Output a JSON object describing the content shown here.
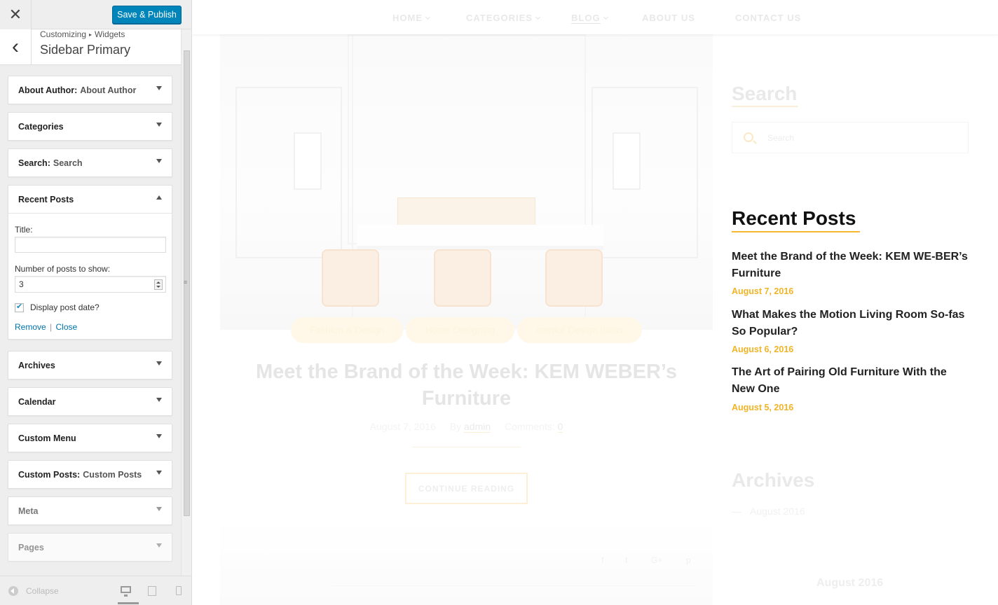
{
  "customizer": {
    "close_glyph": "✕",
    "save_label": "Save & Publish",
    "back_glyph": "‹",
    "breadcrumb_root": "Customizing",
    "breadcrumb_sep": "▸",
    "breadcrumb_section": "Widgets",
    "panel_title": "Sidebar Primary",
    "widgets": [
      {
        "name": "About Author",
        "sub": "About Author",
        "expanded": false
      },
      {
        "name": "Categories",
        "sub": "",
        "expanded": false
      },
      {
        "name": "Search",
        "sub": "Search",
        "expanded": false
      },
      {
        "name": "Recent Posts",
        "sub": "",
        "expanded": true
      },
      {
        "name": "Archives",
        "sub": "",
        "expanded": false
      },
      {
        "name": "Calendar",
        "sub": "",
        "expanded": false
      },
      {
        "name": "Custom Menu",
        "sub": "",
        "expanded": false
      },
      {
        "name": "Custom Posts",
        "sub": "Custom Posts",
        "expanded": false
      },
      {
        "name": "Meta",
        "sub": "",
        "expanded": false
      },
      {
        "name": "Pages",
        "sub": "",
        "expanded": false
      }
    ],
    "recent_posts_form": {
      "title_label": "Title:",
      "title_value": "",
      "number_label": "Number of posts to show:",
      "number_value": "3",
      "display_date_label": "Display post date?",
      "display_date_checked": true,
      "remove_label": "Remove",
      "separator": "|",
      "close_label": "Close"
    },
    "collapse_label": "Collapse",
    "device_icons": [
      "desktop-icon",
      "tablet-icon",
      "mobile-icon"
    ]
  },
  "site": {
    "nav": [
      {
        "label": "HOME",
        "dropdown": true
      },
      {
        "label": "CATEGORIES",
        "dropdown": true
      },
      {
        "label": "BLOG",
        "dropdown": true,
        "active": true
      },
      {
        "label": "ABOUT US",
        "dropdown": false
      },
      {
        "label": "CONTACT US",
        "dropdown": false
      }
    ],
    "post": {
      "categories": [
        "Fashion & Design",
        "Home Designing",
        "Interior Design Ideas"
      ],
      "title": "Meet the Brand of the Week: KEM WEBER’s Furniture",
      "date": "August 7, 2016",
      "by_label": "By",
      "author": "admin",
      "comments_label": "Comments:",
      "comments_count": "0",
      "continue_label": "CONTINUE READING",
      "social_icons": [
        "facebook-icon",
        "twitter-icon",
        "google-plus-icon",
        "pinterest-icon"
      ]
    },
    "sidebar": {
      "search_heading": "Search",
      "search_placeholder": "Search",
      "recent_heading": "Recent Posts",
      "recent_posts": [
        {
          "title": "Meet the Brand of the Week: KEM WE-BER’s Furniture",
          "date": "August 7, 2016"
        },
        {
          "title": "What Makes the Motion Living Room So-fas So Popular?",
          "date": "August 6, 2016"
        },
        {
          "title": "The Art of Pairing Old Furniture With the New One",
          "date": "August 5, 2016"
        }
      ],
      "archives_heading": "Archives",
      "archive_item": "August 2016",
      "calendar_caption": "August 2016"
    }
  },
  "colors": {
    "accent": "#f1b426",
    "primary_button": "#0085ba",
    "link": "#0073aa"
  }
}
